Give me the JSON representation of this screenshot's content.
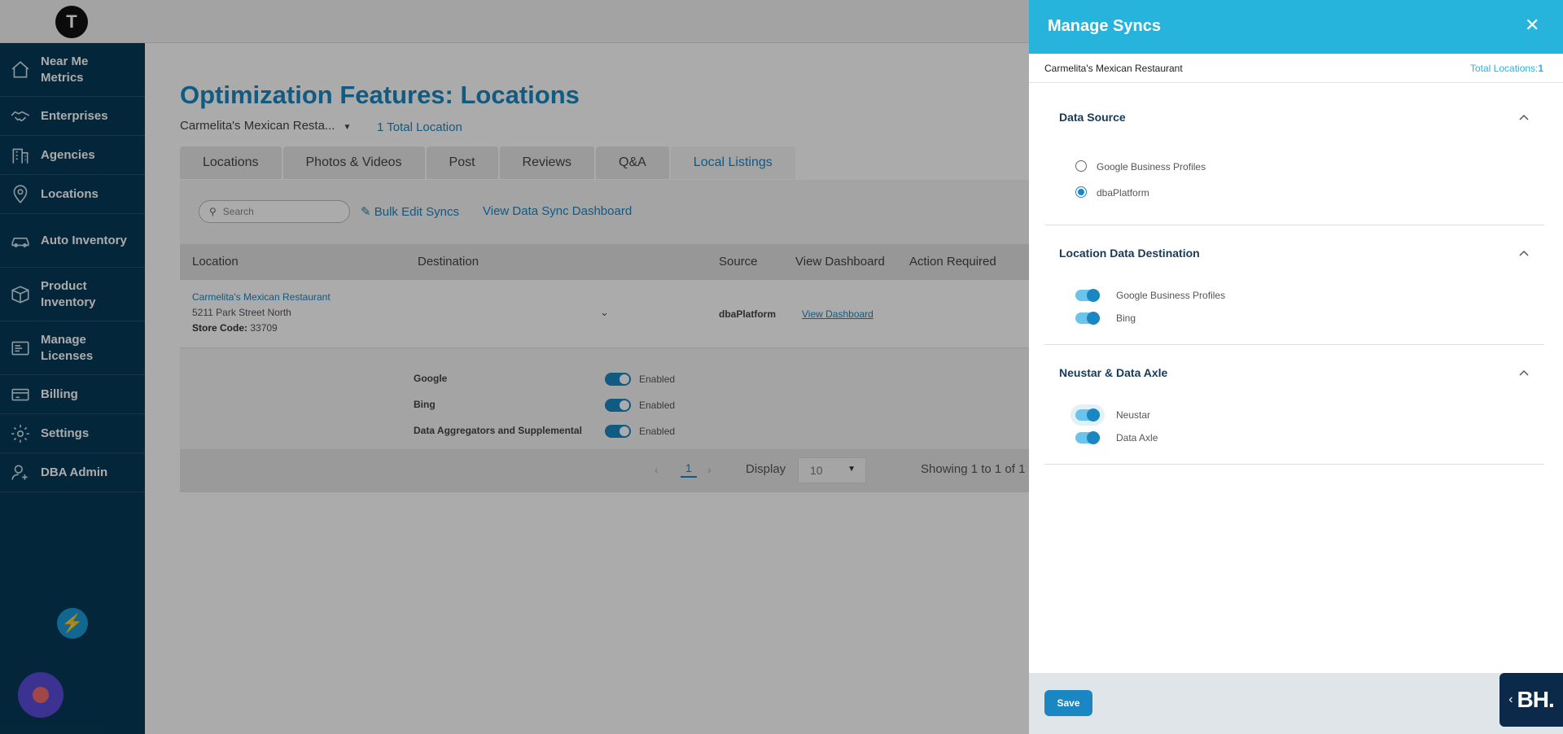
{
  "sidebar": {
    "items": [
      {
        "label": "Near Me Metrics",
        "icon": "home-icon"
      },
      {
        "label": "Enterprises",
        "icon": "handshake-icon"
      },
      {
        "label": "Agencies",
        "icon": "building-icon"
      },
      {
        "label": "Locations",
        "icon": "map-pin-icon"
      },
      {
        "label": "Auto Inventory",
        "icon": "car-icon"
      },
      {
        "label": "Product Inventory",
        "icon": "box-icon"
      },
      {
        "label": "Manage Licenses",
        "icon": "license-icon"
      },
      {
        "label": "Billing",
        "icon": "billing-icon"
      },
      {
        "label": "Settings",
        "icon": "gear-icon"
      },
      {
        "label": "DBA Admin",
        "icon": "user-gear-icon"
      }
    ]
  },
  "page": {
    "title_bold": "Optimization Features:",
    "title_light": " Locations",
    "location_select": "Carmelita's Mexican Resta...",
    "total_locations": "1 Total Location",
    "tabs": [
      "Locations",
      "Photos & Videos",
      "Post",
      "Reviews",
      "Q&A",
      "Local Listings"
    ],
    "active_tab": "Local Listings",
    "search_placeholder": "Search",
    "bulk_edit": "Bulk Edit Syncs",
    "view_dashboard_link": "View Data Sync Dashboard",
    "columns": [
      "Location",
      "Destination",
      "Source",
      "View Dashboard",
      "Action Required"
    ],
    "row": {
      "name": "Carmelita's Mexican Restaurant",
      "address": "5211 Park Street North",
      "store_code_label": "Store Code:",
      "store_code": "33709",
      "source": "dbaPlatform",
      "view_dashboard": "View Dashboard"
    },
    "destinations": [
      {
        "name": "Google",
        "status": "Enabled"
      },
      {
        "name": "Bing",
        "status": "Enabled"
      },
      {
        "name": "Data Aggregators and Supplemental",
        "status": "Enabled"
      }
    ],
    "pager": {
      "page": "1",
      "display_label": "Display",
      "display_value": "10",
      "showing": "Showing 1 to 1 of 1"
    }
  },
  "drawer": {
    "title": "Manage Syncs",
    "location_name": "Carmelita's Mexican Restaurant",
    "total_label": "Total Locations:",
    "total_value": "1",
    "sections": {
      "data_source": {
        "title": "Data Source",
        "options": [
          {
            "label": "Google Business Profiles",
            "checked": false
          },
          {
            "label": "dbaPlatform",
            "checked": true
          }
        ]
      },
      "destination": {
        "title": "Location Data Destination",
        "toggles": [
          {
            "label": "Google Business Profiles",
            "on": true
          },
          {
            "label": "Bing",
            "on": true
          }
        ]
      },
      "aggregators": {
        "title": "Neustar & Data Axle",
        "toggles": [
          {
            "label": "Neustar",
            "on": true
          },
          {
            "label": "Data Axle",
            "on": true
          }
        ]
      }
    },
    "save_label": "Save"
  },
  "badge": {
    "text": "BH."
  },
  "colors": {
    "sidebar": "#073a57",
    "accent": "#1a86c2",
    "drawer_header": "#27b4dc"
  }
}
